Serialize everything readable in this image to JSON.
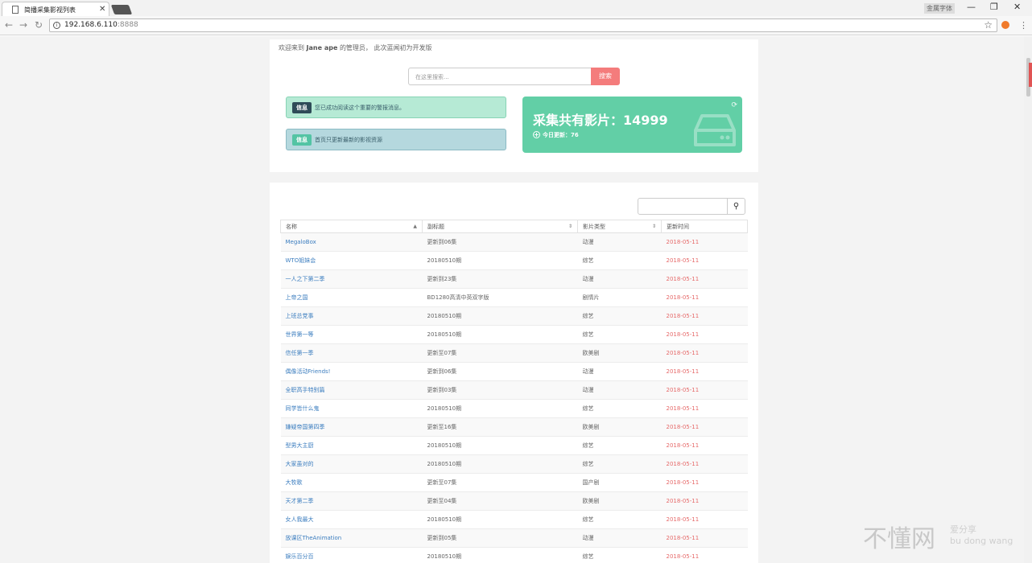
{
  "browser": {
    "tab_title": "简播采集影视列表",
    "user_label": "金属字体",
    "url_host": "192.168.6.110",
    "url_port": ":8888",
    "minimize": "—",
    "maximize": "❐",
    "close": "✕"
  },
  "header": {
    "welcome_prefix": "欢迎来到",
    "welcome_name": "Jane ape",
    "welcome_suffix": "的管理员， 此次蓝闻初为开发版"
  },
  "search": {
    "placeholder": "在这里搜索...",
    "button": "搜索"
  },
  "alerts": [
    {
      "badge": "信息",
      "text": "您已成功阅读这个重要的警报消息。"
    },
    {
      "badge": "信息",
      "text": "首页只更新最新的影视资源"
    }
  ],
  "stat": {
    "title": "采集共有影片：14999",
    "sub": "今日更新：76"
  },
  "table": {
    "headers": [
      "名称",
      "副标题",
      "影片类型",
      "更新时间"
    ],
    "rows": [
      {
        "name": "MegaloBox",
        "subtitle": "更新到06集",
        "type": "动漫",
        "date": "2018-05-11"
      },
      {
        "name": "WTO姐妹会",
        "subtitle": "20180510期",
        "type": "综艺",
        "date": "2018-05-11"
      },
      {
        "name": "一人之下第二季",
        "subtitle": "更新到23集",
        "type": "动漫",
        "date": "2018-05-11"
      },
      {
        "name": "上帝之国",
        "subtitle": "BD1280高清中英双字版",
        "type": "剧情片",
        "date": "2018-05-11"
      },
      {
        "name": "上班总党事",
        "subtitle": "20180510期",
        "type": "综艺",
        "date": "2018-05-11"
      },
      {
        "name": "世界第一等",
        "subtitle": "20180510期",
        "type": "综艺",
        "date": "2018-05-11"
      },
      {
        "name": "信任第一季",
        "subtitle": "更新至07集",
        "type": "欧美剧",
        "date": "2018-05-11"
      },
      {
        "name": "偶像活动Friends!",
        "subtitle": "更新到06集",
        "type": "动漫",
        "date": "2018-05-11"
      },
      {
        "name": "全职高手特别篇",
        "subtitle": "更新到03集",
        "type": "动漫",
        "date": "2018-05-11"
      },
      {
        "name": "同学皆什么鬼",
        "subtitle": "20180510期",
        "type": "综艺",
        "date": "2018-05-11"
      },
      {
        "name": "嫌疑帝国第四季",
        "subtitle": "更新至16集",
        "type": "欧美剧",
        "date": "2018-05-11"
      },
      {
        "name": "型男大主厨",
        "subtitle": "20180510期",
        "type": "综艺",
        "date": "2018-05-11"
      },
      {
        "name": "大家虽对的",
        "subtitle": "20180510期",
        "type": "综艺",
        "date": "2018-05-11"
      },
      {
        "name": "大牧歌",
        "subtitle": "更新至07集",
        "type": "国产剧",
        "date": "2018-05-11"
      },
      {
        "name": "天才第二季",
        "subtitle": "更新至04集",
        "type": "欧美剧",
        "date": "2018-05-11"
      },
      {
        "name": "女人我最大",
        "subtitle": "20180510期",
        "type": "综艺",
        "date": "2018-05-11"
      },
      {
        "name": "放课区TheAnimation",
        "subtitle": "更新到05集",
        "type": "动漫",
        "date": "2018-05-11"
      },
      {
        "name": "娱乐百分百",
        "subtitle": "20180510期",
        "type": "综艺",
        "date": "2018-05-11"
      }
    ]
  },
  "watermark": {
    "main": "不懂网",
    "side_top": "爱分享",
    "side_bottom": "bu dong wang"
  }
}
